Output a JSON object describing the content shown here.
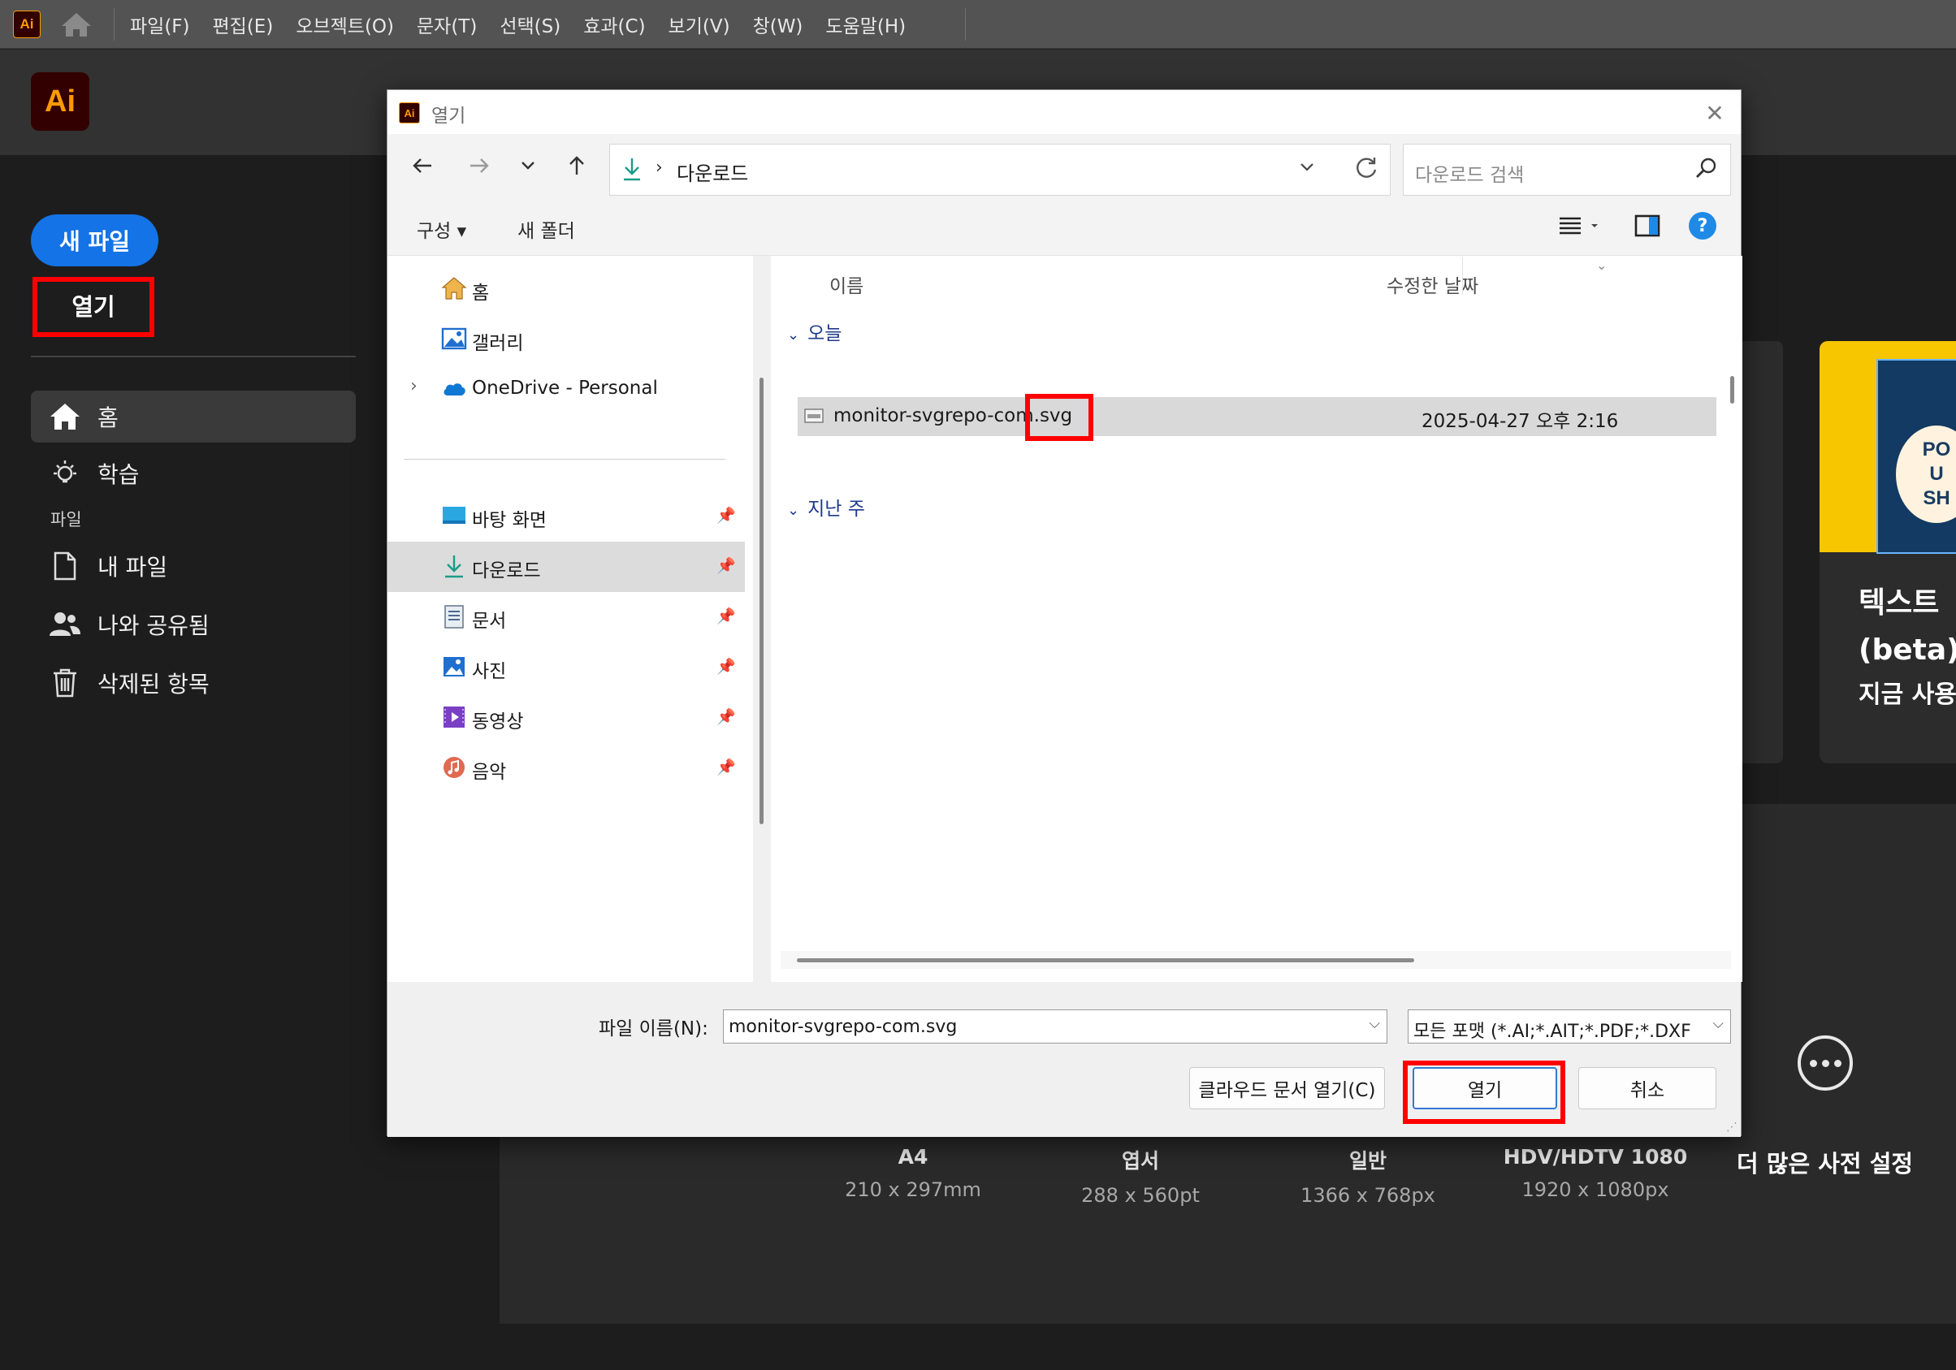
{
  "app": {
    "logo_small": "Ai",
    "logo_large": "Ai",
    "menu": [
      "파일(F)",
      "편집(E)",
      "오브젝트(O)",
      "문자(T)",
      "선택(S)",
      "효과(C)",
      "보기(V)",
      "창(W)",
      "도움말(H)"
    ]
  },
  "sidebar": {
    "new_file": "새 파일",
    "open": "열기",
    "nav": [
      {
        "label": "홈",
        "icon": "home-icon"
      },
      {
        "label": "학습",
        "icon": "lightbulb-icon"
      }
    ],
    "section_files": "파일",
    "files_nav": [
      {
        "label": "내 파일",
        "icon": "file-icon"
      },
      {
        "label": "나와 공유됨",
        "icon": "people-icon"
      },
      {
        "label": "삭제된 항목",
        "icon": "trash-icon"
      }
    ]
  },
  "feature_card": {
    "thumb_text": "PO\nU\nSH",
    "title_line1": "텍스트",
    "title_line2": "(beta)",
    "cta": "지금 사용"
  },
  "presets": [
    {
      "name": "A4",
      "dim": "210 x 297mm"
    },
    {
      "name": "엽서",
      "dim": "288 x 560pt"
    },
    {
      "name": "일반",
      "dim": "1366 x 768px"
    },
    {
      "name": "HDV/HDTV 1080",
      "dim": "1920 x 1080px"
    }
  ],
  "more_presets": "더 많은 사전 설정",
  "dialog": {
    "title": "열기",
    "address": {
      "crumb": "다운로드"
    },
    "search_placeholder": "다운로드 검색",
    "commands": {
      "organize": "구성",
      "new_folder": "새 폴더"
    },
    "nav_tree": [
      {
        "label": "홈",
        "icon": "home-icon",
        "pinned": false
      },
      {
        "label": "갤러리",
        "icon": "gallery-icon",
        "pinned": false
      },
      {
        "label": "OneDrive - Personal",
        "icon": "onedrive-icon",
        "pinned": false,
        "expandable": true
      },
      {
        "label": "바탕 화면",
        "icon": "desktop-icon",
        "pinned": true
      },
      {
        "label": "다운로드",
        "icon": "download-icon",
        "pinned": true,
        "selected": true
      },
      {
        "label": "문서",
        "icon": "document-icon",
        "pinned": true
      },
      {
        "label": "사진",
        "icon": "pictures-icon",
        "pinned": true
      },
      {
        "label": "동영상",
        "icon": "videos-icon",
        "pinned": true
      },
      {
        "label": "음악",
        "icon": "music-icon",
        "pinned": true
      }
    ],
    "columns": {
      "name": "이름",
      "modified": "수정한 날짜"
    },
    "groups": [
      {
        "label": "오늘"
      },
      {
        "label": "지난 주"
      }
    ],
    "files": [
      {
        "name": "monitor-svgrepo-com.svg",
        "modified": "2025-04-27 오후 2:16"
      }
    ],
    "filename_label": "파일 이름(N):",
    "filename_value": "monitor-svgrepo-com.svg",
    "filetype_value": "모든 포맷 (*.AI;*.AIT;*.PDF;*.DXF",
    "buttons": {
      "cloud": "클라우드 문서 열기(C)",
      "open": "열기",
      "cancel": "취소"
    }
  },
  "colors": {
    "accent": "#1473e6",
    "highlight": "#ff0000",
    "ai_brand": "#ff9a00"
  }
}
